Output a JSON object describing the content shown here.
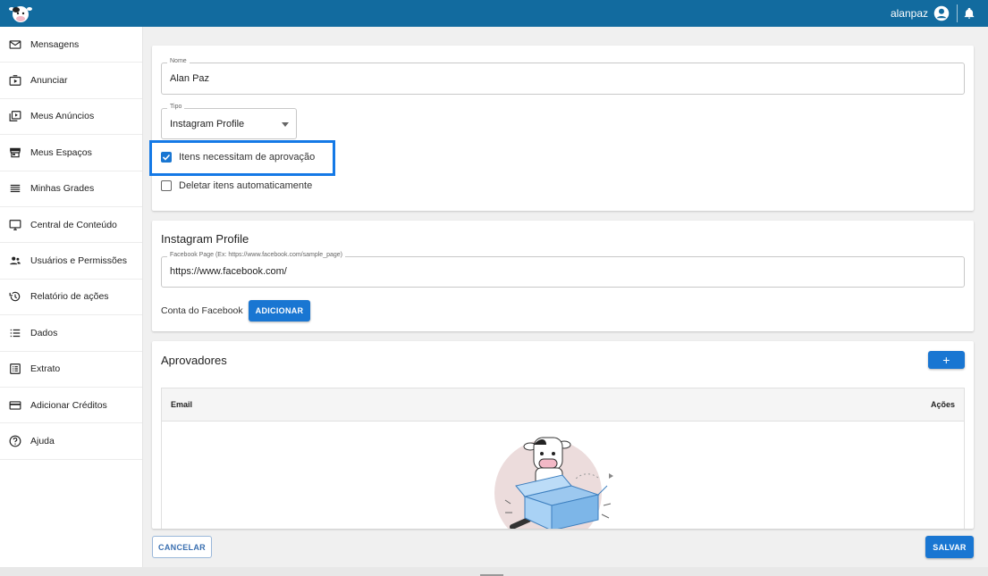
{
  "header": {
    "username": "alanpaz",
    "logo_icon": "cow-logo-icon",
    "account_icon": "account-circle-icon",
    "bell_icon": "bell-icon",
    "bg_color": "#126b9f"
  },
  "sidebar": {
    "items": [
      {
        "label": "Mensagens",
        "icon": "mail-icon"
      },
      {
        "label": "Anunciar",
        "icon": "play-box-icon"
      },
      {
        "label": "Meus Anúncios",
        "icon": "video-library-icon"
      },
      {
        "label": "Meus Espaços",
        "icon": "store-icon"
      },
      {
        "label": "Minhas Grades",
        "icon": "menu-lines-icon"
      },
      {
        "label": "Central de Conteúdo",
        "icon": "monitor-icon"
      },
      {
        "label": "Usuários e Permissões",
        "icon": "people-icon"
      },
      {
        "label": "Relatório de ações",
        "icon": "history-icon"
      },
      {
        "label": "Dados",
        "icon": "list-icon"
      },
      {
        "label": "Extrato",
        "icon": "receipt-icon"
      },
      {
        "label": "Adicionar Créditos",
        "icon": "credit-card-icon"
      },
      {
        "label": "Ajuda",
        "icon": "help-circle-icon"
      }
    ]
  },
  "form": {
    "name_label": "Nome",
    "name_value": "Alan Paz",
    "type_label": "Tipo",
    "type_value": "Instagram Profile",
    "approval_label": "Itens necessitam de aprovação",
    "approval_checked": true,
    "delete_label": "Deletar itens automaticamente",
    "delete_checked": false
  },
  "instagram": {
    "title": "Instagram Profile",
    "fb_page_label": "Facebook Page (Ex: https://www.facebook.com/sample_page)",
    "fb_page_value": "https://www.facebook.com/",
    "fb_account_label": "Conta do Facebook",
    "add_button": "ADICIONAR"
  },
  "approvers": {
    "title": "Aprovadores",
    "add_button": "+",
    "columns": [
      "Email",
      "Ações"
    ],
    "empty_illustration": "cow-box-illustration"
  },
  "footer": {
    "cancel": "CANCELAR",
    "save": "SALVAR"
  },
  "colors": {
    "primary": "#1976d2",
    "highlight": "#1479e6"
  }
}
